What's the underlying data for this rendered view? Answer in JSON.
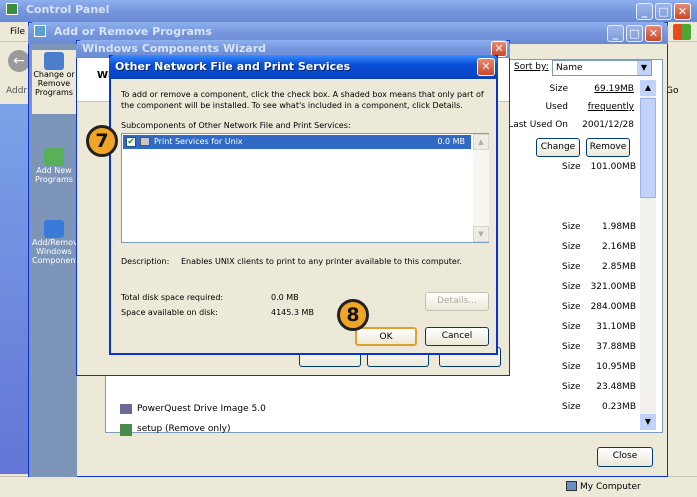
{
  "control_panel": {
    "title": "Control Panel",
    "menu_file": "File",
    "address_label": "Addr",
    "go_label": "Go"
  },
  "arp": {
    "title": "Add or Remove Programs",
    "sort_by_label": "Sort by:",
    "sort_by_value": "Name",
    "sidebar": [
      {
        "label": "Change or Remove Programs"
      },
      {
        "label": "Add New Programs"
      },
      {
        "label": "Add/Remove Windows Components"
      }
    ],
    "info": [
      {
        "label": "Size",
        "value": "69.19MB"
      },
      {
        "label": "Used",
        "value": "frequently"
      },
      {
        "label": "Last Used On",
        "value": "2001/12/28"
      }
    ],
    "change_button": "Change",
    "remove_button": "Remove",
    "size_rows": [
      {
        "label": "Size",
        "value": "101.00MB"
      },
      {
        "label": "Size",
        "value": "1.98MB"
      },
      {
        "label": "Size",
        "value": "2.16MB"
      },
      {
        "label": "Size",
        "value": "2.85MB"
      },
      {
        "label": "Size",
        "value": "321.00MB"
      },
      {
        "label": "Size",
        "value": "284.00MB"
      },
      {
        "label": "Size",
        "value": "31.10MB"
      },
      {
        "label": "Size",
        "value": "37.88MB"
      },
      {
        "label": "Size",
        "value": "10.95MB"
      },
      {
        "label": "Size",
        "value": "23.48MB"
      },
      {
        "label": "Size",
        "value": "0.23MB"
      }
    ],
    "programs": [
      {
        "name": "PowerQuest Drive Image 5.0"
      },
      {
        "name": "setup (Remove only)"
      }
    ],
    "close_button": "Close"
  },
  "wizard": {
    "title": "Windows Components Wizard",
    "heading_partial": "Wi"
  },
  "dialog": {
    "title": "Other Network File and Print Services",
    "description": "To add or remove a component, click the check box. A shaded box means that only part of the component will be installed. To see what's included in a component, click Details.",
    "subcomponents_label": "Subcomponents of Other Network File and Print Services:",
    "items": [
      {
        "name": "Print Services for Unix",
        "size": "0.0 MB",
        "checked": true
      }
    ],
    "description_label": "Description:",
    "description_text": "Enables UNIX clients to print to any printer available to this computer.",
    "total_disk_label": "Total disk space required:",
    "total_disk_value": "0.0 MB",
    "space_available_label": "Space available on disk:",
    "space_available_value": "4145.3 MB",
    "details_button": "Details...",
    "ok_button": "OK",
    "cancel_button": "Cancel"
  },
  "badges": {
    "step7": "7",
    "step8": "8"
  },
  "status_bar": {
    "computer_label": "My Computer"
  },
  "colors": {
    "title_blue": "#0a4fd8",
    "dialog_bg": "#ece9d8",
    "badge_orange": "#f0a526",
    "selection_blue": "#316ac5"
  }
}
